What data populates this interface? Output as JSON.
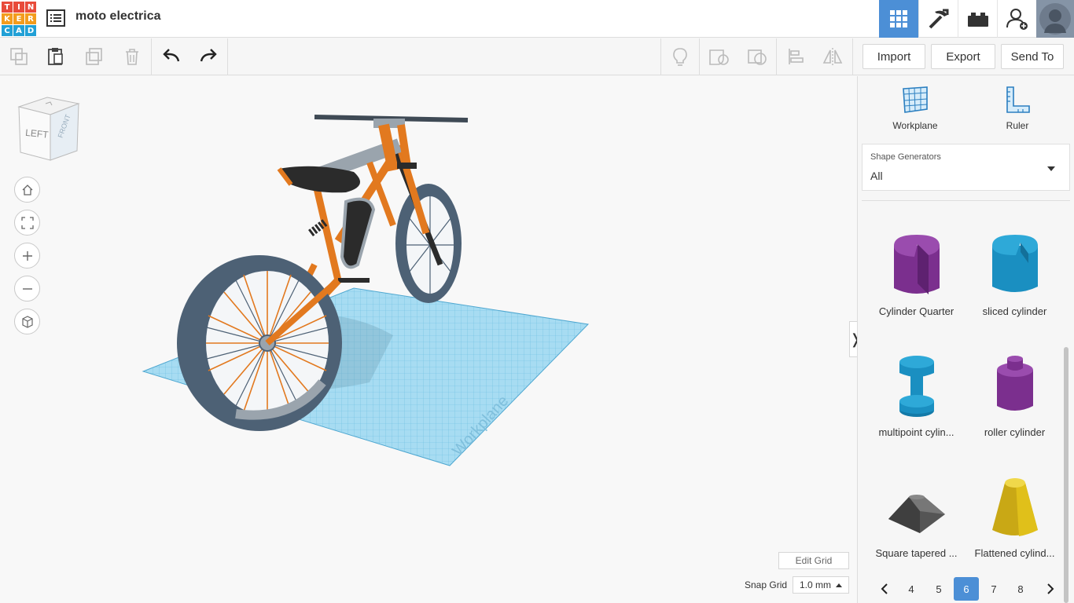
{
  "app": {
    "logo_letters": [
      "T",
      "I",
      "N",
      "K",
      "E",
      "R",
      "C",
      "A",
      "D"
    ],
    "logo_colors": [
      "#e84b3a",
      "#e84b3a",
      "#e84b3a",
      "#f39c1d",
      "#f39c1d",
      "#f39c1d",
      "#21a0d6",
      "#21a0d6",
      "#21a0d6"
    ],
    "title": "moto electrica"
  },
  "header": {
    "icons": [
      "grid-view-icon",
      "pickaxe-icon",
      "brick-icon",
      "add-user-icon",
      "avatar"
    ]
  },
  "toolbar": {
    "import_label": "Import",
    "export_label": "Export",
    "send_to_label": "Send To"
  },
  "viewport": {
    "viewcube_left": "LEFT",
    "viewcube_front": "FRONT",
    "workplane_label": "Workplane",
    "edit_grid_label": "Edit Grid",
    "snap_grid_label": "Snap Grid",
    "snap_grid_value": "1.0 mm",
    "panel_toggle": "❭"
  },
  "panel": {
    "tools": [
      {
        "label": "Workplane"
      },
      {
        "label": "Ruler"
      }
    ],
    "generators": {
      "label": "Shape Generators",
      "value": "All"
    },
    "shapes": [
      {
        "label": "Cylinder Quarter",
        "color": "#7b2f8e"
      },
      {
        "label": "sliced cylinder",
        "color": "#1a8fc1"
      },
      {
        "label": "multipoint cylin...",
        "color": "#1a8fc1"
      },
      {
        "label": "roller cylinder",
        "color": "#7b2f8e"
      },
      {
        "label": "Square tapered ...",
        "color": "#555555"
      },
      {
        "label": "Flattened cylind...",
        "color": "#e0c01a"
      }
    ],
    "pager": {
      "pages": [
        "4",
        "5",
        "6",
        "7",
        "8"
      ],
      "current": "6"
    }
  },
  "colors": {
    "accent": "#4c8fd6",
    "workplane": "#8fd3ef"
  }
}
